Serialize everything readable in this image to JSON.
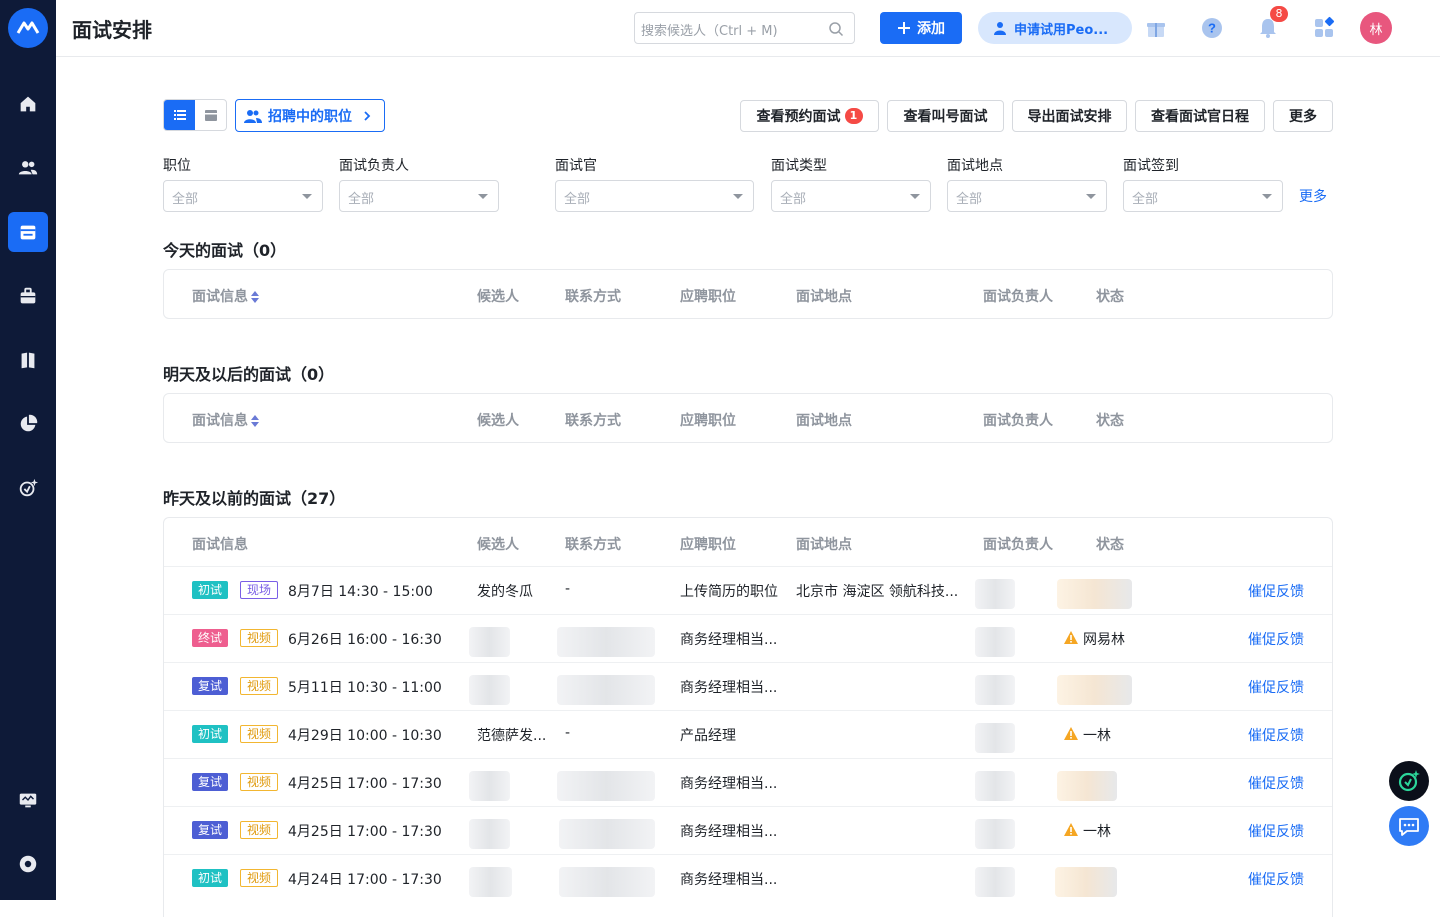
{
  "header": {
    "title": "面试安排",
    "search_placeholder": "搜索候选人（Ctrl + M)",
    "add_label": "添加",
    "trial_label": "申请试用Peo...",
    "notification_count": "8",
    "avatar_text": "林"
  },
  "toolbar": {
    "job_filter": "招聘中的职位",
    "buttons": [
      {
        "label": "查看预约面试",
        "badge": "1"
      },
      {
        "label": "查看叫号面试"
      },
      {
        "label": "导出面试安排"
      },
      {
        "label": "查看面试官日程"
      },
      {
        "label": "更多"
      }
    ]
  },
  "filters": [
    {
      "label": "职位",
      "value": "全部"
    },
    {
      "label": "面试负责人",
      "value": "全部"
    },
    {
      "label": "面试官",
      "value": "全部"
    },
    {
      "label": "面试类型",
      "value": "全部"
    },
    {
      "label": "面试地点",
      "value": "全部"
    },
    {
      "label": "面试签到",
      "value": "全部"
    }
  ],
  "filters_more": "更多",
  "columns": [
    "面试信息",
    "候选人",
    "联系方式",
    "应聘职位",
    "面试地点",
    "面试负责人",
    "状态"
  ],
  "sections": {
    "today": "今天的面试（0）",
    "tomorrow": "明天及以后的面试（0）",
    "past": "昨天及以前的面试（27）"
  },
  "rows": [
    {
      "stage": "初试",
      "stage_type": "first",
      "mode": "现场",
      "mode_type": "onsite",
      "time": "8月7日 14:30 - 15:00",
      "candidate": "发的冬瓜",
      "contact": "-",
      "position": "上传简历的职位",
      "location": "北京市 海淀区 领航科技...",
      "status": "",
      "action": "催促反馈"
    },
    {
      "stage": "终试",
      "stage_type": "final",
      "mode": "视频",
      "mode_type": "video",
      "time": "6月26日 16:00 - 16:30",
      "candidate": "",
      "contact": "",
      "position": "商务经理相当...",
      "location": "",
      "status": "网易林",
      "action": "催促反馈"
    },
    {
      "stage": "复试",
      "stage_type": "re",
      "mode": "视频",
      "mode_type": "video",
      "time": "5月11日 10:30 - 11:00",
      "candidate": "",
      "contact": "",
      "position": "商务经理相当...",
      "location": "",
      "status": "",
      "action": "催促反馈"
    },
    {
      "stage": "初试",
      "stage_type": "first",
      "mode": "视频",
      "mode_type": "video",
      "time": "4月29日 10:00 - 10:30",
      "candidate": "范德萨发...",
      "contact": "-",
      "position": "产品经理",
      "location": "",
      "status": "一林",
      "action": "催促反馈"
    },
    {
      "stage": "复试",
      "stage_type": "re",
      "mode": "视频",
      "mode_type": "video",
      "time": "4月25日 17:00 - 17:30",
      "candidate": "",
      "contact": "",
      "position": "商务经理相当...",
      "location": "",
      "status": "",
      "action": "催促反馈"
    },
    {
      "stage": "复试",
      "stage_type": "re",
      "mode": "视频",
      "mode_type": "video",
      "time": "4月25日 17:00 - 17:30",
      "candidate": "",
      "contact": "",
      "position": "商务经理相当...",
      "location": "",
      "status": "一林",
      "action": "催促反馈"
    },
    {
      "stage": "初试",
      "stage_type": "first",
      "mode": "视频",
      "mode_type": "video",
      "time": "4月24日 17:00 - 17:30",
      "candidate": "",
      "contact": "",
      "position": "商务经理相当...",
      "location": "",
      "status": "",
      "action": "催促反馈"
    }
  ]
}
